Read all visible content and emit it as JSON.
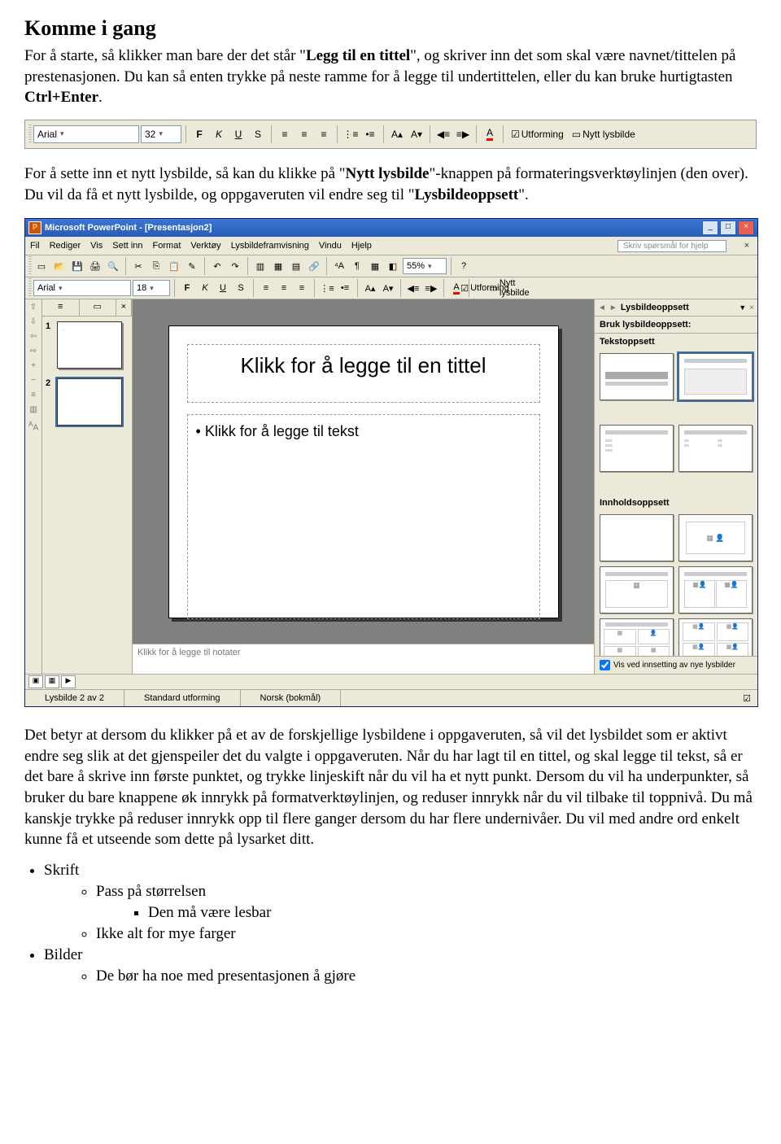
{
  "heading": "Komme i gang",
  "para1a": "For å starte, så klikker man bare der det står \"",
  "para1b": "Legg til en tittel",
  "para1c": "\", og skriver inn det som skal være navnet/tittelen på prestenasjonen. Du kan så enten trykke på neste ramme for å legge til undertittelen, eller du kan bruke hurtigtasten ",
  "para1d": "Ctrl+Enter",
  "para1e": ".",
  "toolbar1": {
    "font": "Arial",
    "size": "32",
    "bold": "F",
    "italic": "K",
    "under": "U",
    "utforming": "Utforming",
    "nytt": "Nytt lysbilde"
  },
  "para2a": "For å sette inn et nytt lysbilde, så kan du klikke på \"",
  "para2b": "Nytt lysbilde",
  "para2c": "\"-knappen på formateringsverktøylinjen (den over). Du vil da få et nytt lysbilde, og oppgaveruten vil endre seg til \"",
  "para2d": "Lysbildeoppsett",
  "para2e": "\".",
  "pp": {
    "title": "Microsoft PowerPoint - [Presentasjon2]",
    "menu": [
      "Fil",
      "Rediger",
      "Vis",
      "Sett inn",
      "Format",
      "Verktøy",
      "Lysbildeframvisning",
      "Vindu",
      "Hjelp"
    ],
    "helpPlaceholder": "Skriv spørsmål for hjelp",
    "zoom": "55%",
    "font": "Arial",
    "size": "18",
    "utforming": "Utforming",
    "nytt": "Nytt lysbilde",
    "slideTitle": "Klikk for å legge til en tittel",
    "slideBody": "Klikk for å legge til tekst",
    "notes": "Klikk for å legge til notater",
    "taskpane": {
      "title": "Lysbildeoppsett",
      "apply": "Bruk lysbildeoppsett:",
      "sec1": "Tekstoppsett",
      "sec2": "Innholdsoppsett",
      "footer": "Vis ved innsetting av nye lysbilder"
    },
    "status": {
      "slide": "Lysbilde 2 av 2",
      "design": "Standard utforming",
      "lang": "Norsk (bokmål)"
    }
  },
  "para3": "Det betyr at dersom du klikker på et av de forskjellige lysbildene i oppgaveruten, så vil det lysbildet som er aktivt endre seg slik at det gjenspeiler det du valgte i oppgaveruten. Når du har lagt til en tittel, og skal legge til tekst, så er det bare å skrive inn første punktet, og trykke linjeskift når du vil ha et nytt punkt. Dersom du vil ha underpunkter, så bruker du bare knappene øk innrykk på formatverktøylinjen, og reduser innrykk når du vil tilbake til toppnivå. Du må kanskje trykke på reduser innrykk opp til flere ganger dersom du har flere undernivåer. Du vil med andre ord enkelt kunne få et utseende som dette på lysarket ditt.",
  "list": {
    "skrift": "Skrift",
    "pass": "Pass på størrelsen",
    "lesbar": "Den må være lesbar",
    "farger": "Ikke alt for mye farger",
    "bilder": "Bilder",
    "noe": "De bør ha noe med presentasjonen å gjøre"
  }
}
